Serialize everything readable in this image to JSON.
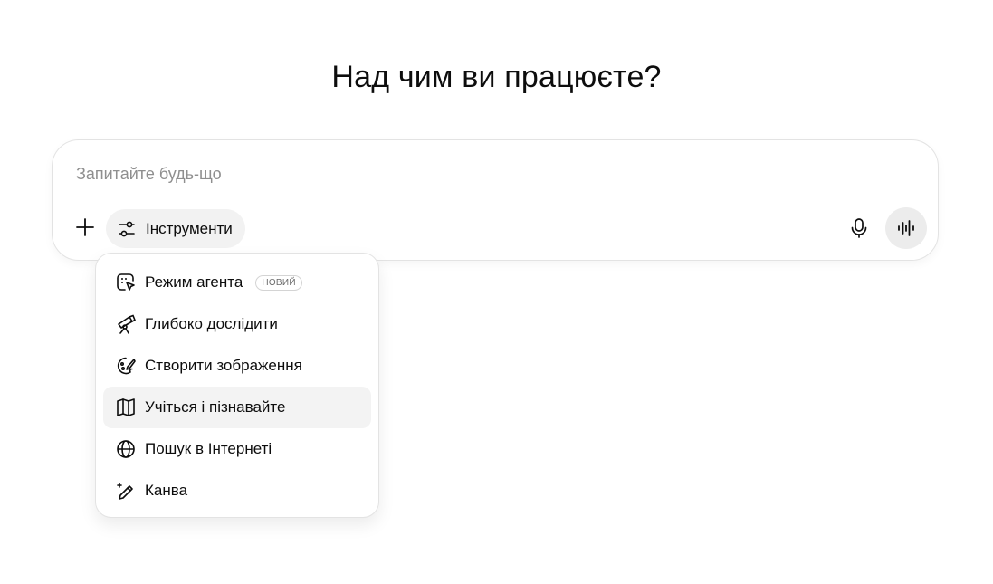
{
  "heading": "Над чим ви працюєте?",
  "composer": {
    "placeholder": "Запитайте будь-що",
    "value": "",
    "tools_label": "Інструменти",
    "icons": {
      "add": "plus-icon",
      "tools": "sliders-icon",
      "mic": "microphone-icon",
      "voice": "voice-mode-icon"
    }
  },
  "tools_menu": {
    "items": [
      {
        "label": "Режим агента",
        "icon": "agent-cursor-icon",
        "badge": "НОВИЙ"
      },
      {
        "label": "Глибоко дослідити",
        "icon": "telescope-icon"
      },
      {
        "label": "Створити зображення",
        "icon": "palette-icon"
      },
      {
        "label": "Учіться і пізнавайте",
        "icon": "book-open-icon",
        "highlighted": true
      },
      {
        "label": "Пошук в Інтернеті",
        "icon": "globe-icon"
      },
      {
        "label": "Канва",
        "icon": "pen-sparkle-icon"
      }
    ]
  },
  "colors": {
    "text": "#0d0d0d",
    "placeholder": "#8f8f8f",
    "button_bg": "#f2f2f2",
    "border": "#e3e3e3"
  }
}
